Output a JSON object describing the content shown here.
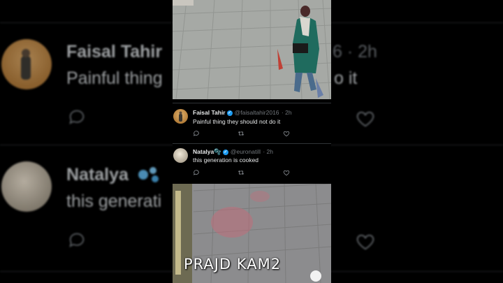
{
  "tweets": [
    {
      "author": "Faisal Tahir",
      "handle": "@faisaltahir2016",
      "time": "· 2h",
      "text": "Painful thing they should not do it",
      "verified": true
    },
    {
      "author": "Natalya",
      "author_emoji": "🫧",
      "handle": "@euronatill",
      "time": "· 2h",
      "text": "this generation is cooked",
      "verified": true
    }
  ],
  "background": {
    "tweet1_name": "Faisal Tahir",
    "tweet1_meta": "6 · 2h",
    "tweet1_text": "Painful thing",
    "tweet1_text_tail": "o it",
    "tweet2_name": "Natalya",
    "tweet2_text": "this generati"
  },
  "video_overlay": {
    "caption": "PRAJD KAM2"
  },
  "icons": {
    "reply": "reply-icon",
    "retweet": "retweet-icon",
    "like": "like-icon",
    "verified": "verified-badge-icon"
  },
  "colors": {
    "background": "#000000",
    "verified_blue": "#1d9bf0",
    "text": "#e7e9ea",
    "muted": "#71767b",
    "divider": "#2f3336"
  }
}
